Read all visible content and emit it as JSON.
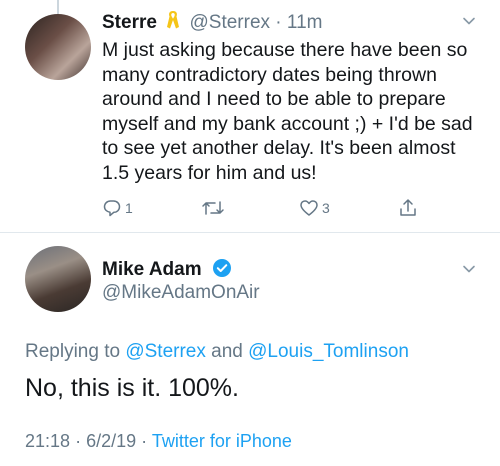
{
  "tweet1": {
    "name": "Sterre",
    "handle": "@Sterrex",
    "separator": "·",
    "time": "11m",
    "text": "M just asking because there have been so many contradictory dates being thrown around and I need to be able to prepare myself and my bank account ;) + I'd be sad to see yet another delay. It's been almost 1.5 years for him and us!",
    "reply_count": "1",
    "like_count": "3"
  },
  "tweet2": {
    "name": "Mike Adam",
    "handle": "@MikeAdamOnAir",
    "replying_prefix": "Replying to",
    "replying_user1": "@Sterrex",
    "replying_and": "and",
    "replying_user2": "@Louis_Tomlinson",
    "text": "No, this is it. 100%.",
    "time": "21:18",
    "date": "6/2/19",
    "meta_sep": "·",
    "source": "Twitter for iPhone"
  },
  "colors": {
    "text": "#14171a",
    "muted": "#657786",
    "link": "#1da1f2",
    "verified": "#1da1f2",
    "ribbon": "#f5c518",
    "divider": "#e1e8ed"
  }
}
